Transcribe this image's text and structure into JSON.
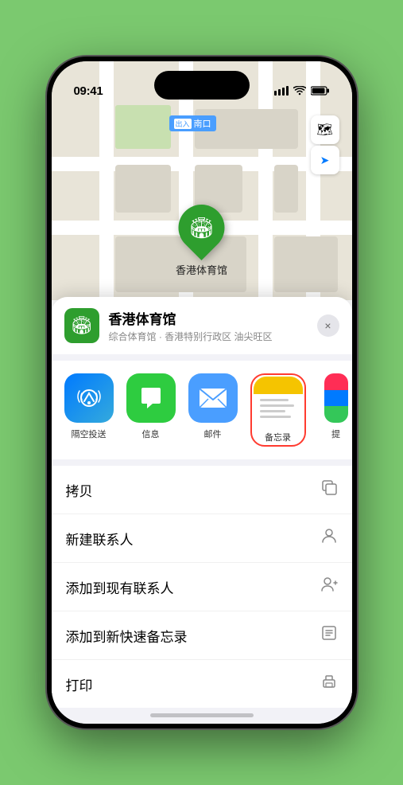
{
  "status_bar": {
    "time": "09:41",
    "location_arrow": "▲",
    "signal": "▌▌▌",
    "wifi": "wifi",
    "battery": "▮"
  },
  "map": {
    "label": "南口",
    "label_prefix": "出入"
  },
  "venue": {
    "name": "香港体育馆",
    "subtitle": "综合体育馆 · 香港特别行政区 油尖旺区",
    "close_label": "×"
  },
  "share_items": [
    {
      "id": "airdrop",
      "label": "隔空投送"
    },
    {
      "id": "messages",
      "label": "信息"
    },
    {
      "id": "mail",
      "label": "邮件"
    },
    {
      "id": "notes",
      "label": "备忘录"
    },
    {
      "id": "more",
      "label": "提"
    }
  ],
  "actions": [
    {
      "label": "拷贝",
      "icon": "copy"
    },
    {
      "label": "新建联系人",
      "icon": "person"
    },
    {
      "label": "添加到现有联系人",
      "icon": "person-add"
    },
    {
      "label": "添加到新快速备忘录",
      "icon": "note"
    },
    {
      "label": "打印",
      "icon": "print"
    }
  ],
  "map_controls": {
    "layer_icon": "🗺",
    "location_icon": "➤"
  }
}
